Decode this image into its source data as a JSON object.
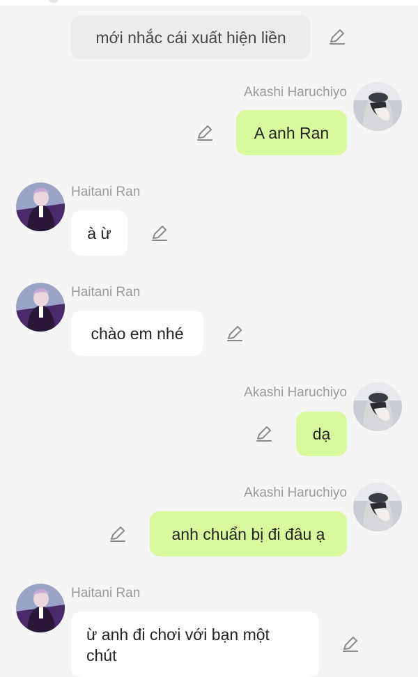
{
  "colors": {
    "background": "#f5f5f5",
    "bubble_left": "#ffffff",
    "bubble_right": "#d9f99d",
    "bubble_system": "#ececec",
    "name_text": "#9a9a9a",
    "icon": "#8a8a8a"
  },
  "messages": [
    {
      "type": "system",
      "text": "mới nhắc cái xuất hiện liền",
      "icon": "pencil-icon"
    },
    {
      "type": "right",
      "sender": "Akashi Haruchiyo",
      "text": "A anh Ran",
      "icon": "pencil-icon"
    },
    {
      "type": "left",
      "sender": "Haitani Ran",
      "text": "à ừ",
      "icon": "pencil-icon"
    },
    {
      "type": "left",
      "sender": "Haitani Ran",
      "text": "chào em nhé",
      "icon": "pencil-icon"
    },
    {
      "type": "right",
      "sender": "Akashi Haruchiyo",
      "text": "dạ",
      "icon": "pencil-icon"
    },
    {
      "type": "right",
      "sender": "Akashi Haruchiyo",
      "text": "anh chuẩn bị đi đâu ạ",
      "icon": "pencil-icon"
    },
    {
      "type": "left",
      "sender": "Haitani Ran",
      "text": "ừ anh đi chơi với bạn một chút",
      "icon": "pencil-icon"
    }
  ]
}
